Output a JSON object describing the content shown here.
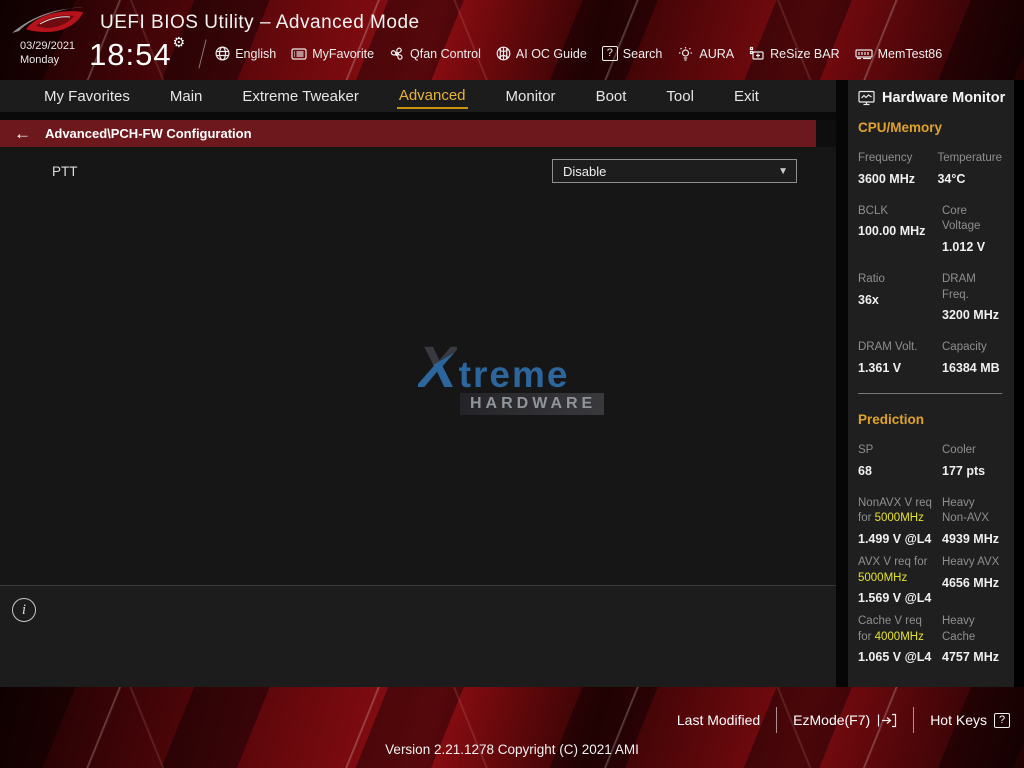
{
  "header": {
    "title": "UEFI BIOS Utility – Advanced Mode",
    "date": "03/29/2021",
    "day": "Monday",
    "time": "18:54",
    "quick_items": [
      {
        "label": "English",
        "icon": "globe-icon"
      },
      {
        "label": "MyFavorite",
        "icon": "favorite-list-icon"
      },
      {
        "label": "Qfan Control",
        "icon": "fan-icon"
      },
      {
        "label": "AI OC Guide",
        "icon": "ai-oc-icon"
      },
      {
        "label": "Search",
        "icon": "search-icon"
      },
      {
        "label": "AURA",
        "icon": "aura-lamp-icon"
      },
      {
        "label": "ReSize BAR",
        "icon": "resize-bar-icon"
      },
      {
        "label": "MemTest86",
        "icon": "memtest-icon"
      }
    ]
  },
  "tabs": {
    "items": [
      {
        "label": "My Favorites",
        "active": false
      },
      {
        "label": "Main",
        "active": false
      },
      {
        "label": "Extreme Tweaker",
        "active": false
      },
      {
        "label": "Advanced",
        "active": true
      },
      {
        "label": "Monitor",
        "active": false
      },
      {
        "label": "Boot",
        "active": false
      },
      {
        "label": "Tool",
        "active": false
      },
      {
        "label": "Exit",
        "active": false
      }
    ]
  },
  "breadcrumb": {
    "label": "Advanced\\PCH-FW Configuration"
  },
  "content": {
    "setting_label": "PTT",
    "setting_value": "Disable",
    "watermark_x": "X",
    "watermark_line1": "treme",
    "watermark_line2": "HARDWARE"
  },
  "sidebar": {
    "title": "Hardware Monitor",
    "section_cpu": "CPU/Memory",
    "cpu_rows": [
      {
        "l_label": "Frequency",
        "l_value": "3600 MHz",
        "r_label": "Temperature",
        "r_value": "34°C"
      },
      {
        "l_label": "BCLK",
        "l_value": "100.00 MHz",
        "r_label": "Core Voltage",
        "r_value": "1.012 V"
      },
      {
        "l_label": "Ratio",
        "l_value": "36x",
        "r_label": "DRAM Freq.",
        "r_value": "3200 MHz"
      },
      {
        "l_label": "DRAM Volt.",
        "l_value": "1.361 V",
        "r_label": "Capacity",
        "r_value": "16384 MB"
      }
    ],
    "section_prediction": "Prediction",
    "pred_rows": [
      {
        "l_label": "SP",
        "l_value": "68",
        "r_label": "Cooler",
        "r_value": "177 pts"
      }
    ],
    "pred_freq_rows": [
      {
        "l_pre": "NonAVX V req for ",
        "l_freq": "5000MHz",
        "l_value": "1.499 V @L4",
        "r_label": "Heavy Non-AVX",
        "r_value": "4939 MHz"
      },
      {
        "l_pre": "AVX V req for ",
        "l_freq": "5000MHz",
        "l_value": "1.569 V @L4",
        "r_label": "Heavy AVX",
        "r_value": "4656 MHz"
      },
      {
        "l_pre": "Cache V req for ",
        "l_freq": "4000MHz",
        "l_value": "1.065 V @L4",
        "r_label": "Heavy Cache",
        "r_value": "4757 MHz"
      }
    ]
  },
  "footer": {
    "last_modified": "Last Modified",
    "ezmode": "EzMode(F7)",
    "hot_keys": "Hot Keys",
    "version": "Version 2.21.1278 Copyright (C) 2021 AMI"
  },
  "icons": {
    "back_arrow": "←",
    "gear": "⚙",
    "dropdown_arrow": "▼",
    "search_glyph": "?",
    "hotkeys_glyph": "?",
    "info_glyph": "i"
  },
  "colors": {
    "accent_gold": "#e7b33c",
    "highlight_yellow": "#e4e22e",
    "breadcrumb_red": "#6d181d",
    "watermark_blue": "#2f6da8"
  }
}
